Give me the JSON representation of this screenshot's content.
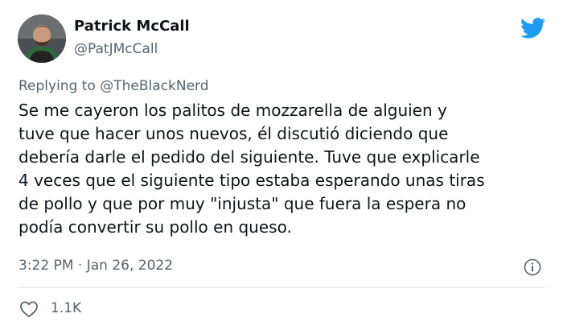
{
  "author": {
    "display_name": "Patrick McCall",
    "handle": "@PatJMcCall"
  },
  "reply": {
    "prefix": "Replying to",
    "mention": "@TheBlackNerd"
  },
  "tweet": {
    "lines": [
      "Se me cayeron los palitos de mozzarella de alguien y",
      "tuve que hacer unos nuevos, él discutió diciendo que",
      "debería darle el pedido del siguiente. Tuve que explicarle",
      "4 veces que el siguiente tipo estaba esperando unas tiras",
      "de pollo y que por muy \"injusta\" que fuera la espera no",
      "podía convertir su pollo en queso."
    ],
    "timestamp": "3:22 PM · Jan 26, 2022"
  },
  "engagement": {
    "likes": "1.1K"
  },
  "icons": {
    "brand": "twitter-bird-icon",
    "info": "info-icon",
    "like": "heart-icon"
  },
  "colors": {
    "brand": "#1d9bf0",
    "text": "#0f1419",
    "muted": "#536471",
    "divider": "#e1e8ed"
  }
}
